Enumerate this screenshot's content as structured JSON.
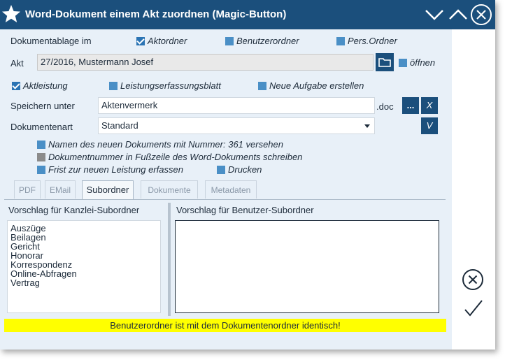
{
  "window": {
    "title": "Word-Dokument einem Akt zuordnen (Magic-Button)"
  },
  "ablage": {
    "label": "Dokumentablage im",
    "options": [
      {
        "label": "Aktordner",
        "checked": true
      },
      {
        "label": "Benutzerordner",
        "checked": false
      },
      {
        "label": "Pers.Ordner",
        "checked": false
      }
    ]
  },
  "akt": {
    "label": "Akt",
    "value": "27/2016, Mustermann Josef",
    "open_label": "öffnen"
  },
  "flags": {
    "aktleistung": "Aktleistung",
    "leistungsblatt": "Leistungserfassungsblatt",
    "aufgabe": "Neue Aufgabe erstellen"
  },
  "speichern": {
    "label": "Speichern unter",
    "value": "Aktenvermerk",
    "ext": ".doc",
    "browse_label": "...",
    "clear_label": "X"
  },
  "dokumentenart": {
    "label": "Dokumentenart",
    "value": "Standard",
    "confirm_label": "V"
  },
  "options": {
    "nummer": "Namen des neuen Dokuments mit Nummer: 361 versehen",
    "fusszeile": "Dokumentnummer in Fußzeile des Word-Dokuments schreiben",
    "frist": "Frist zur neuen Leistung erfassen",
    "drucken": "Drucken"
  },
  "tabs": [
    "PDF",
    "EMail",
    "Subordner",
    "Dokumente",
    "Metadaten"
  ],
  "active_tab": "Subordner",
  "subordner": {
    "kanzlei_label": "Vorschlag für Kanzlei-Subordner",
    "kanzlei_items": [
      "Auszüge",
      "Beilagen",
      "Gericht",
      "Honorar",
      "Korrespondenz",
      "Online-Abfragen",
      "Vertrag"
    ],
    "benutzer_label": "Vorschlag für Benutzer-Subordner"
  },
  "status_message": "Benutzerordner ist mit dem Dokumentenordner identisch!",
  "colors": {
    "titlebar": "#1b4f7c",
    "content_bg": "#e8f0f8",
    "checkbox": "#4a8fc6",
    "status_bg": "#ffff00"
  },
  "icons": {
    "app": "star-icon",
    "minimize": "chevron-down-icon",
    "maximize": "chevron-up-icon",
    "close": "close-icon",
    "folder": "folder-icon",
    "cancel": "cancel-circle-icon",
    "confirm": "checkmark-icon"
  }
}
